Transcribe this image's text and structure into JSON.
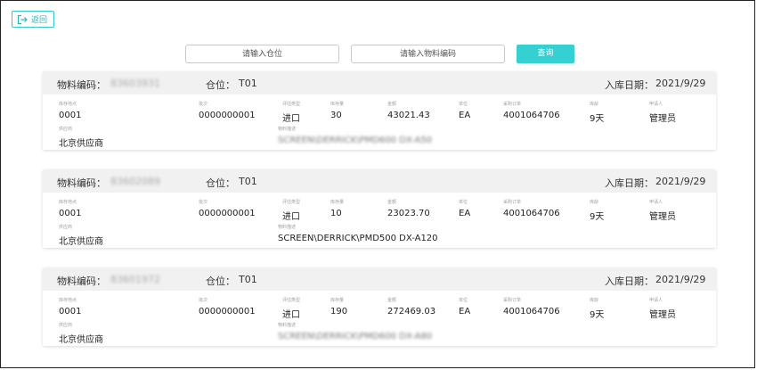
{
  "toolbar": {
    "back_label": "返回",
    "back_icon": "exit-arrow-icon"
  },
  "search": {
    "location_placeholder": "请输入仓位",
    "material_placeholder": "请输入物料编码",
    "query_label": "查询"
  },
  "header_labels": {
    "code": "物料编码：",
    "location": "仓位：",
    "date": "入库日期："
  },
  "field_labels": {
    "storage_location": "库存地点",
    "batch": "批次",
    "valuation_type": "评估类型",
    "stock_qty": "库存量",
    "amount": "金额",
    "unit": "单位",
    "purchase_order": "采购订单",
    "age": "库龄",
    "applicant": "申请人",
    "supplier": "供应商",
    "description": "物料描述"
  },
  "cards": [
    {
      "code": "83603931",
      "location": "T01",
      "date": "2021/9/29",
      "storage_location": "0001",
      "batch": "0000000001",
      "valuation_type": "进口",
      "stock_qty": "30",
      "amount": "43021.43",
      "unit": "EA",
      "purchase_order": "4001064706",
      "age": "9天",
      "applicant": "管理员",
      "supplier": "北京供应商",
      "description": "SCREEN\\DERRICK\\PMD600 DX-A50"
    },
    {
      "code": "83602089",
      "location": "T01",
      "date": "2021/9/29",
      "storage_location": "0001",
      "batch": "0000000001",
      "valuation_type": "进口",
      "stock_qty": "10",
      "amount": "23023.70",
      "unit": "EA",
      "purchase_order": "4001064706",
      "age": "9天",
      "applicant": "管理员",
      "supplier": "北京供应商",
      "description": "SCREEN\\DERRICK\\PMD500 DX-A120"
    },
    {
      "code": "83601972",
      "location": "T01",
      "date": "2021/9/29",
      "storage_location": "0001",
      "batch": "0000000001",
      "valuation_type": "进口",
      "stock_qty": "190",
      "amount": "272469.03",
      "unit": "EA",
      "purchase_order": "4001064706",
      "age": "9天",
      "applicant": "管理员",
      "supplier": "北京供应商",
      "description": "SCREEN\\DERRICK\\PMD600 DX-A80"
    }
  ]
}
